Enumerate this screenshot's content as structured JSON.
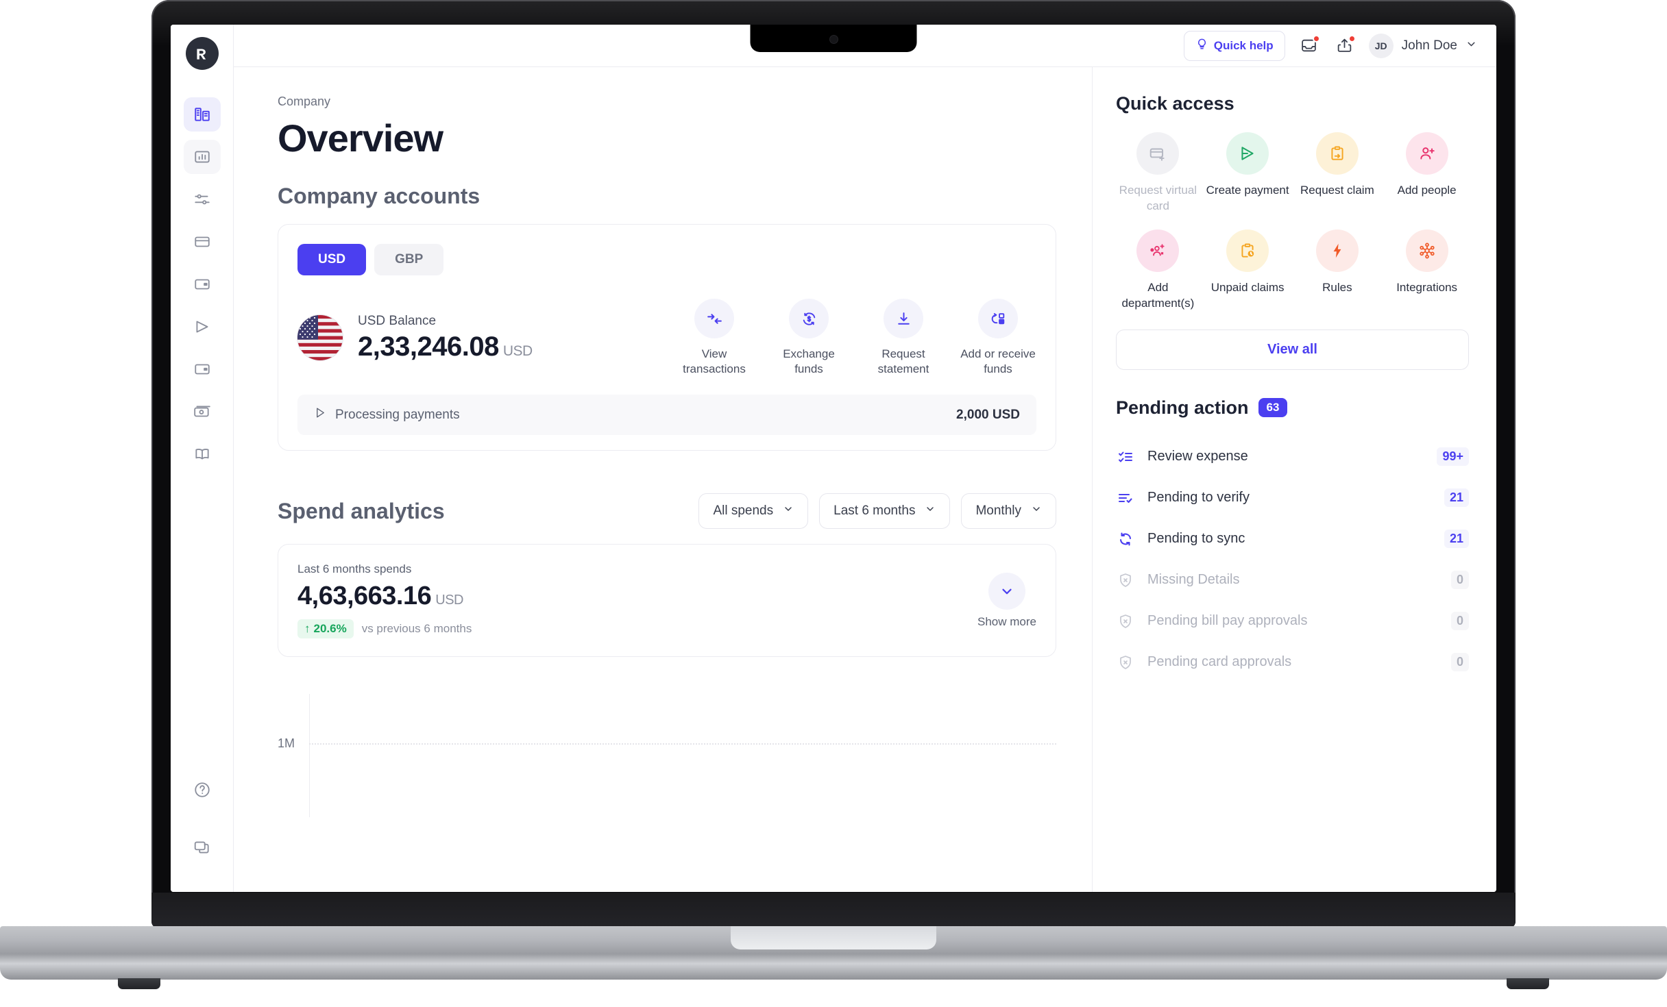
{
  "topbar": {
    "quick_help": "Quick help",
    "inbox_icon": "inbox-icon",
    "share_icon": "share-icon",
    "avatar_initials": "JD",
    "user_name": "John Doe"
  },
  "sidebar": {
    "logo": "volopay-logo",
    "items": [
      {
        "name": "company-overview",
        "icon": "building-icon",
        "active": true
      },
      {
        "name": "analytics",
        "icon": "chart-icon",
        "active": false
      },
      {
        "name": "settings-sliders",
        "icon": "sliders-icon",
        "active": false
      },
      {
        "name": "cards",
        "icon": "credit-card-icon",
        "active": false
      },
      {
        "name": "wallet",
        "icon": "wallet-icon",
        "active": false
      },
      {
        "name": "payments",
        "icon": "send-icon",
        "active": false
      },
      {
        "name": "reimbursements",
        "icon": "wallet-alt-icon",
        "active": false
      },
      {
        "name": "accounting",
        "icon": "money-icon",
        "active": false
      },
      {
        "name": "ledger",
        "icon": "book-icon",
        "active": false
      }
    ],
    "bottom_items": [
      {
        "name": "help",
        "icon": "help-circle-icon"
      },
      {
        "name": "chat-support",
        "icon": "chat-icon"
      }
    ]
  },
  "main": {
    "breadcrumb": "Company",
    "page_title": "Overview",
    "accounts_section_title": "Company accounts",
    "currency_tabs": [
      {
        "label": "USD",
        "active": true
      },
      {
        "label": "GBP",
        "active": false
      }
    ],
    "balance": {
      "flag": "us-flag-icon",
      "label": "USD Balance",
      "amount": "2,33,246.08",
      "currency": "USD"
    },
    "account_actions": [
      {
        "label": "View transactions",
        "icon": "transactions-arrows-icon"
      },
      {
        "label": "Exchange funds",
        "icon": "exchange-dollar-icon"
      },
      {
        "label": "Request statement",
        "icon": "download-icon"
      },
      {
        "label": "Add or receive funds",
        "icon": "add-funds-icon"
      }
    ],
    "processing": {
      "icon": "send-outline-icon",
      "label": "Processing payments",
      "amount": "2,000 USD"
    },
    "spend": {
      "section_title": "Spend analytics",
      "filters": [
        {
          "label": "All spends",
          "icon": "chevron-down-icon"
        },
        {
          "label": "Last 6 months",
          "icon": "chevron-down-icon"
        },
        {
          "label": "Monthly",
          "icon": "chevron-down-icon"
        }
      ],
      "summary_label": "Last 6 months spends",
      "summary_amount": "4,63,663.16",
      "summary_currency": "USD",
      "delta_arrow": "↑",
      "delta_value": "20.6%",
      "delta_note": "vs previous 6 months",
      "show_more_label": "Show more",
      "show_more_icon": "chevron-down-icon"
    }
  },
  "chart_data": {
    "type": "bar",
    "title": "Spend analytics",
    "categories": [],
    "values": [],
    "x": [],
    "xlabel": "",
    "ylabel": "",
    "ytick_labels": [
      "1M"
    ],
    "ylim": [
      0,
      1000000
    ],
    "grid": true,
    "legend": "none",
    "note": "Chart is cut off by the viewport; only the 1M gridline and y-axis are visible."
  },
  "side": {
    "quick_access_title": "Quick access",
    "quick_access": [
      {
        "label": "Request virtual card",
        "icon": "card-plus-icon",
        "bg": "#f1f1f4",
        "fg": "#b4b7c2",
        "disabled": true
      },
      {
        "label": "Create payment",
        "icon": "send-icon",
        "bg": "#e3f6ec",
        "fg": "#20a765",
        "disabled": false
      },
      {
        "label": "Request claim",
        "icon": "clipboard-arrow-icon",
        "bg": "#fdf1d7",
        "fg": "#f5a623",
        "disabled": false
      },
      {
        "label": "Add people",
        "icon": "user-plus-icon",
        "bg": "#fde4ec",
        "fg": "#e8336d",
        "disabled": false
      },
      {
        "label": "Add department(s)",
        "icon": "people-plus-icon",
        "bg": "#fbe0ec",
        "fg": "#e8336d",
        "disabled": false
      },
      {
        "label": "Unpaid claims",
        "icon": "clipboard-clock-icon",
        "bg": "#fdf3d9",
        "fg": "#f5a623",
        "disabled": false
      },
      {
        "label": "Rules",
        "icon": "bolt-icon",
        "bg": "#fdeae7",
        "fg": "#f05a28",
        "disabled": false
      },
      {
        "label": "Integrations",
        "icon": "nodes-icon",
        "bg": "#fdeae7",
        "fg": "#f05a28",
        "disabled": false
      }
    ],
    "view_all_label": "View all",
    "pending_title": "Pending action",
    "pending_badge": "63",
    "pending_items": [
      {
        "label": "Review expense",
        "count": "99+",
        "icon": "checklist-icon",
        "disabled": false
      },
      {
        "label": "Pending to verify",
        "count": "21",
        "icon": "list-check-icon",
        "disabled": false
      },
      {
        "label": "Pending to sync",
        "count": "21",
        "icon": "sync-icon",
        "disabled": false
      },
      {
        "label": "Missing Details",
        "count": "0",
        "icon": "shield-x-icon",
        "disabled": true
      },
      {
        "label": "Pending bill pay approvals",
        "count": "0",
        "icon": "shield-x-icon",
        "disabled": true
      },
      {
        "label": "Pending card approvals",
        "count": "0",
        "icon": "shield-x-icon",
        "disabled": true
      }
    ]
  },
  "colors": {
    "primary": "#4b3ff0",
    "primary_soft": "#f3f3fb",
    "text": "#161a2b",
    "muted": "#8b8f9c",
    "success": "#17a55b",
    "danger": "#ef3e36",
    "border": "#ececf1"
  }
}
